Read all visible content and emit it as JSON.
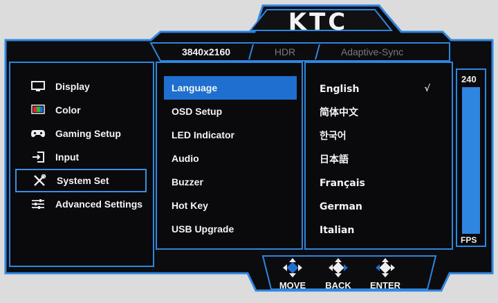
{
  "brand": "KTC",
  "status_tabs": [
    {
      "label": "3840x2160",
      "active": true
    },
    {
      "label": "HDR",
      "active": false
    },
    {
      "label": "Adaptive-Sync",
      "active": false
    }
  ],
  "left_menu": [
    {
      "label": "Display",
      "icon": "monitor-icon"
    },
    {
      "label": "Color",
      "icon": "color-palette-icon"
    },
    {
      "label": "Gaming Setup",
      "icon": "gamepad-icon"
    },
    {
      "label": "Input",
      "icon": "input-arrow-icon"
    },
    {
      "label": "System Set",
      "icon": "wrench-screwdriver-icon",
      "selected": true
    },
    {
      "label": "Advanced Settings",
      "icon": "sliders-icon"
    }
  ],
  "middle_menu": [
    {
      "label": "Language",
      "selected": true
    },
    {
      "label": "OSD Setup"
    },
    {
      "label": "LED Indicator"
    },
    {
      "label": "Audio"
    },
    {
      "label": "Buzzer"
    },
    {
      "label": "Hot Key"
    },
    {
      "label": "USB Upgrade"
    }
  ],
  "language_options": [
    {
      "label": "English",
      "checked": true
    },
    {
      "label": "简体中文"
    },
    {
      "label": "한국어"
    },
    {
      "label": "日本語"
    },
    {
      "label": "Français"
    },
    {
      "label": "German"
    },
    {
      "label": "Italian"
    }
  ],
  "checkmark": "√",
  "fps_meter": {
    "value": "240",
    "unit": "FPS",
    "fill_fraction": 1.0
  },
  "nav_hints": [
    {
      "label": "MOVE",
      "icon": "dpad-move-icon"
    },
    {
      "label": "BACK",
      "icon": "dpad-back-icon"
    },
    {
      "label": "ENTER",
      "icon": "dpad-enter-icon"
    }
  ],
  "colors": {
    "accent_blue": "#1e6fd0",
    "frame_blue": "#2f86e0",
    "panel_bg": "#0c0c0e",
    "text": "#f4f4f4"
  }
}
